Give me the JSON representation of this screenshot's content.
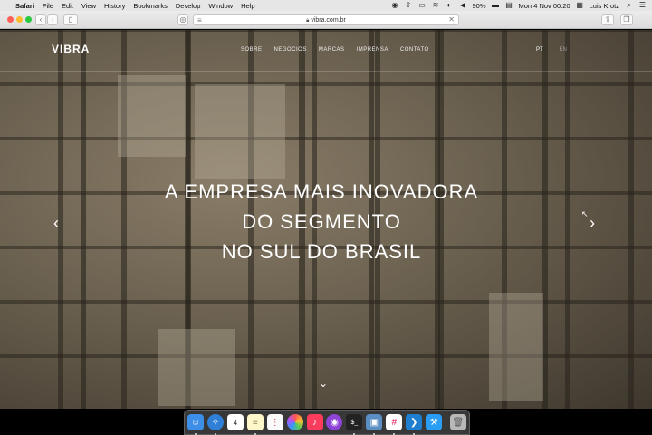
{
  "menubar": {
    "apple": "",
    "app_name": "Safari",
    "menus": [
      "File",
      "Edit",
      "View",
      "History",
      "Bookmarks",
      "Develop",
      "Window",
      "Help"
    ],
    "battery": "90%",
    "datetime": "Mon 4 Nov  00:20",
    "user": "Luis Krotz"
  },
  "browser": {
    "url": "vibra.com.br"
  },
  "site": {
    "logo": "VIBRA",
    "nav": [
      "SOBRE",
      "NEGOCIOS",
      "MARCAS",
      "IMPRENSA",
      "CONTATO"
    ],
    "lang": [
      "PT",
      "EN"
    ],
    "headline": [
      "A EMPRESA MAIS INOVADORA",
      "DO SEGMENTO",
      "NO SUL DO BRASIL"
    ]
  },
  "dock": {
    "apps": [
      "finder-icon",
      "safari-icon",
      "calendar-icon",
      "notes-icon",
      "reminders-icon",
      "photos-icon",
      "music-icon",
      "podcast-icon",
      "terminal-icon",
      "preview-icon",
      "slack-icon",
      "vscode-icon",
      "xcode-icon",
      "trash-icon"
    ],
    "calendar_day": "4"
  }
}
